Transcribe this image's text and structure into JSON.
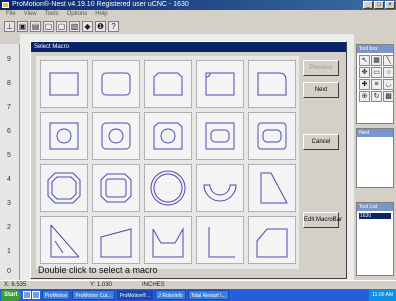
{
  "window": {
    "title": "ProMotion®-Nest v4.19.10 Registered user uCNC - 1630",
    "buttons": [
      "_",
      "□",
      "×"
    ]
  },
  "menu": [
    "File",
    "View",
    "Tools",
    "Options",
    "Help"
  ],
  "ruler_ticks": [
    "9",
    "8",
    "7",
    "6",
    "5",
    "4",
    "3",
    "2",
    "1",
    "0"
  ],
  "dialog": {
    "title": "Select Macro",
    "caption": "Double click to select a macro",
    "buttons": {
      "previous": "Previous",
      "next": "Next",
      "cancel": "Cancel",
      "edit": "Edit MacroBar"
    }
  },
  "right_panels": {
    "toolbox": "Tool box",
    "nest": "Nest",
    "tool_list": "Tool List",
    "tool_list_value": "1630"
  },
  "status": {
    "x": "X: 6.535",
    "y": "Y: 1.030",
    "units": "INCHES"
  },
  "taskbar": {
    "start": "Start",
    "tasks": [
      "ProMotion",
      "ProMotion Cut...",
      "ProMotion®...",
      "2 RoboInfo",
      "Total Restart I..."
    ],
    "clock": "11:00 AM"
  }
}
